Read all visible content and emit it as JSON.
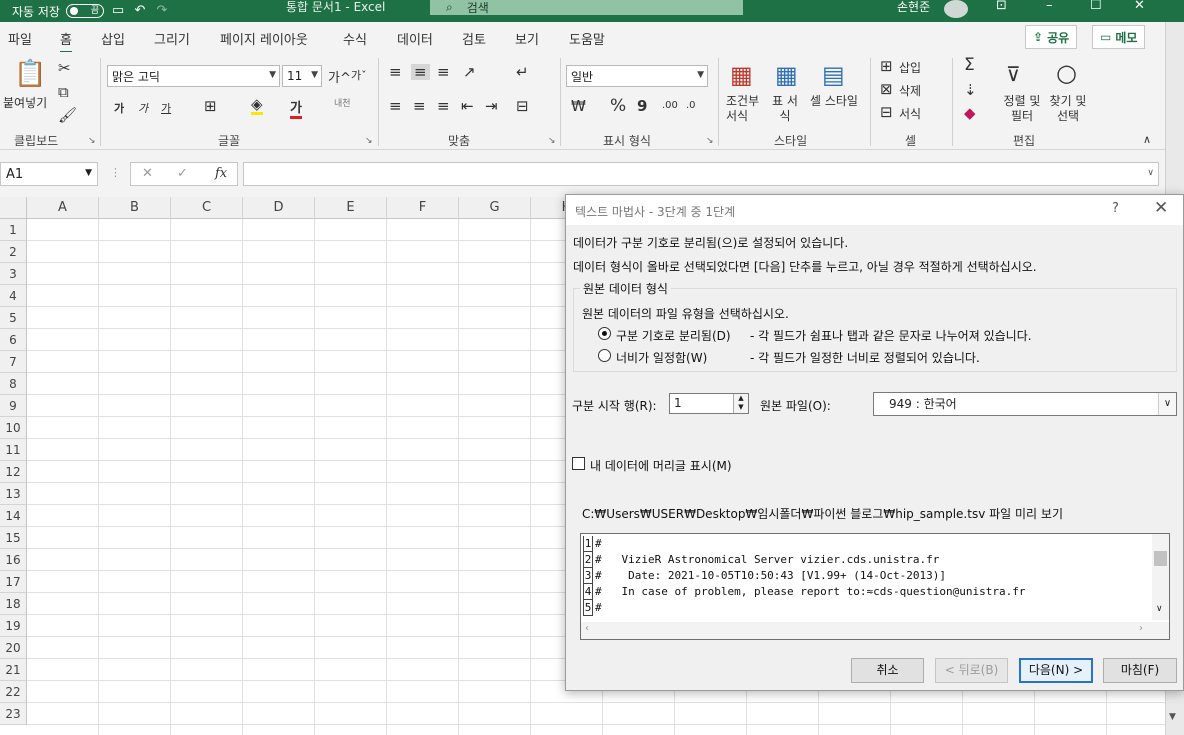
{
  "titlebar": {
    "autosave_label": "자동 저장",
    "autosave_state": "끔",
    "doc_title": "통합 문서1  -  Excel",
    "search_placeholder": "검색",
    "user_name": "손현준"
  },
  "menu": {
    "items": [
      "파일",
      "홈",
      "삽입",
      "그리기",
      "페이지 레이아웃",
      "수식",
      "데이터",
      "검토",
      "보기",
      "도움말"
    ],
    "active": "홈",
    "share_label": "공유",
    "memo_label": "메모"
  },
  "ribbon": {
    "clipboard": {
      "paste_label": "붙여넣기",
      "group_label": "클립보드"
    },
    "font": {
      "font_name": "맑은 고딕",
      "font_size": "11",
      "bold": "가",
      "italic": "가",
      "underline": "가",
      "group_label": "글꼴",
      "grow": "가",
      "shrink": "가",
      "font_color_glyph": "가",
      "phonetic": "내천"
    },
    "alignment": {
      "group_label": "맞춤"
    },
    "number": {
      "format": "일반",
      "group_label": "표시 형식"
    },
    "styles": {
      "conditional": "조건부 서식",
      "table": "표 서식",
      "cell": "셀 스타일",
      "group_label": "스타일"
    },
    "cells": {
      "insert": "삽입",
      "delete": "삭제",
      "format": "서식",
      "group_label": "셀"
    },
    "editing": {
      "sort": "정렬 및 필터",
      "find": "찾기 및 선택",
      "group_label": "편집"
    }
  },
  "formula_bar": {
    "name_box": "A1",
    "fx": "fx"
  },
  "grid": {
    "columns": [
      "A",
      "B",
      "C",
      "D",
      "E",
      "F",
      "G",
      "H"
    ],
    "rows": [
      "1",
      "2",
      "3",
      "4",
      "5",
      "6",
      "7",
      "8",
      "9",
      "10",
      "11",
      "12",
      "13",
      "14",
      "15",
      "16",
      "17",
      "18",
      "19",
      "20",
      "21",
      "22",
      "23"
    ]
  },
  "dialog": {
    "title": "텍스트 마법사 - 3단계 중 1단계",
    "help": "?",
    "line1": "데이터가 구분 기호로 분리됨(으)로 설정되어 있습니다.",
    "line2": "데이터 형식이 올바로 선택되었다면 [다음] 단추를 누르고, 아닐 경우 적절하게 선택하십시오.",
    "group_title": "원본 데이터 형식",
    "group_prompt": "원본 데이터의 파일 유형을 선택하십시오.",
    "option_delimited": "구분 기호로 분리됨(D)",
    "option_delimited_desc": "- 각 필드가 쉼표나 탭과 같은 문자로 나누어져 있습니다.",
    "option_fixed": "너비가 일정함(W)",
    "option_fixed_desc": "- 각 필드가 일정한 너비로 정렬되어 있습니다.",
    "start_row_label": "구분 시작 행(R):",
    "start_row_value": "1",
    "origin_label": "원본 파일(O):",
    "origin_value": "949 : 한국어",
    "headers_label": "내 데이터에 머리글 표시(M)",
    "preview_label": "C:₩Users₩USER₩Desktop₩임시폴더₩파이썬 블로그₩hip_sample.tsv 파일 미리 보기",
    "preview_lines": [
      {
        "n": "1",
        "text": "#"
      },
      {
        "n": "2",
        "text": "#   VizieR Astronomical Server vizier.cds.unistra.fr"
      },
      {
        "n": "3",
        "text": "#    Date: 2021-10-05T10:50:43 [V1.99+ (14-Oct-2013)]"
      },
      {
        "n": "4",
        "text": "#   In case of problem, please report to:≈cds-question@unistra.fr"
      },
      {
        "n": "5",
        "text": "#"
      }
    ],
    "buttons": {
      "cancel": "취소",
      "back": "< 뒤로(B)",
      "next": "다음(N) >",
      "finish": "마침(F)"
    }
  },
  "colors": {
    "excel_green": "#1e7145",
    "ribbon_bg": "#f3f3f3",
    "dialog_bg": "#f0f0f0",
    "primary_border": "#2b72c8"
  }
}
